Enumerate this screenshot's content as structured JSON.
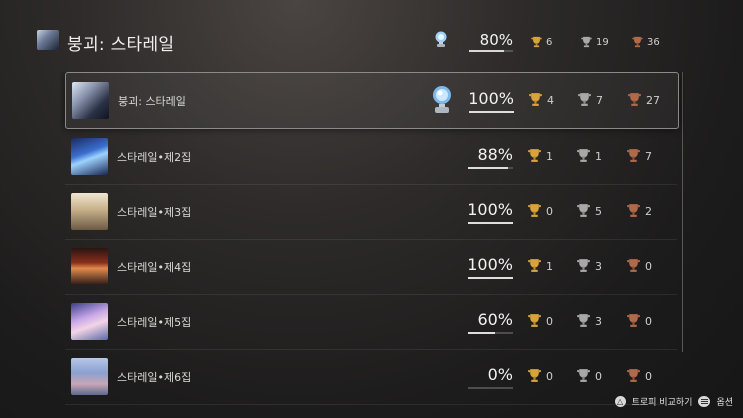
{
  "header": {
    "game_title": "붕괴: 스타레일",
    "progress_pct": "80%",
    "progress_fraction": 0.8,
    "gold": "6",
    "silver": "19",
    "bronze": "36"
  },
  "rows": [
    {
      "title": "붕괴: 스타레일",
      "pct": "100%",
      "fraction": 1.0,
      "platinum": true,
      "gold": "4",
      "silver": "7",
      "bronze": "27"
    },
    {
      "title": "스타레일•제2집",
      "pct": "88%",
      "fraction": 0.88,
      "platinum": false,
      "gold": "1",
      "silver": "1",
      "bronze": "7"
    },
    {
      "title": "스타레일•제3집",
      "pct": "100%",
      "fraction": 1.0,
      "platinum": false,
      "gold": "0",
      "silver": "5",
      "bronze": "2"
    },
    {
      "title": "스타레일•제4집",
      "pct": "100%",
      "fraction": 1.0,
      "platinum": false,
      "gold": "1",
      "silver": "3",
      "bronze": "0"
    },
    {
      "title": "스타레일•제5집",
      "pct": "60%",
      "fraction": 0.6,
      "platinum": false,
      "gold": "0",
      "silver": "3",
      "bronze": "0"
    },
    {
      "title": "스타레일•제6집",
      "pct": "0%",
      "fraction": 0.0,
      "platinum": false,
      "gold": "0",
      "silver": "0",
      "bronze": "0"
    }
  ],
  "footer": {
    "compare_label": "트로피 비교하기",
    "compare_button_glyph": "△",
    "options_label": "옵션"
  },
  "colors": {
    "gold": "#d8a33a",
    "silver": "#a8a8a8",
    "bronze": "#b06a4a",
    "platinum": "#8fc4f0"
  },
  "icons": {
    "trophy": "trophy-icon",
    "platinum": "platinum-trophy-icon",
    "options": "options-icon"
  }
}
